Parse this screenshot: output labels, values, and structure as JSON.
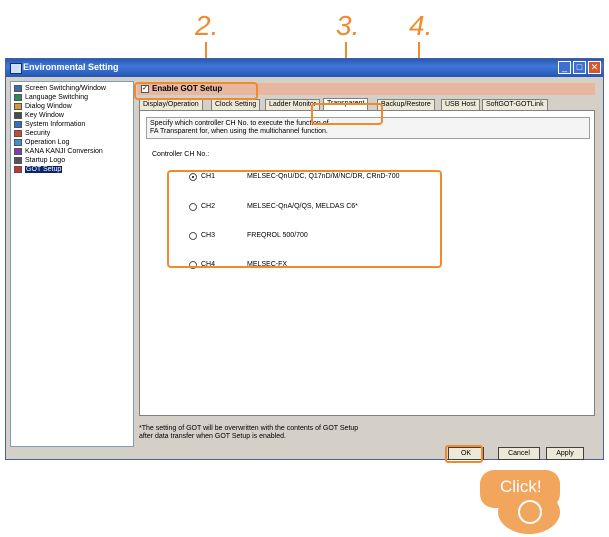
{
  "callouts": [
    "2.",
    "3.",
    "4."
  ],
  "window": {
    "title": "Environmental Setting",
    "controls": [
      "minimize-icon",
      "maximize-icon",
      "close-icon"
    ]
  },
  "tree": {
    "items": [
      {
        "label": "Screen Switching/Window",
        "icon": "screen-icon",
        "color": "#3a6ea5"
      },
      {
        "label": "Language Switching",
        "icon": "language-icon",
        "color": "#2e8b57"
      },
      {
        "label": "Dialog Window",
        "icon": "dialog-icon",
        "color": "#d49c2c"
      },
      {
        "label": "Key Window",
        "icon": "key-window-icon",
        "color": "#4a4a4a"
      },
      {
        "label": "System Information",
        "icon": "system-info-icon",
        "color": "#2f73c9"
      },
      {
        "label": "Security",
        "icon": "security-icon",
        "color": "#c94a2f"
      },
      {
        "label": "Operation Log",
        "icon": "operation-log-icon",
        "color": "#3c8fd0"
      },
      {
        "label": "KANA KANJI Conversion",
        "icon": "kana-kanji-icon",
        "color": "#7a3fb0"
      },
      {
        "label": "Startup Logo",
        "icon": "startup-logo-icon",
        "color": "#555555"
      },
      {
        "label": "GOT Setup",
        "icon": "got-setup-icon",
        "color": "#c0392b"
      }
    ],
    "selected": "GOT Setup"
  },
  "enable": {
    "label": "Enable GOT Setup",
    "checked": true
  },
  "tabs": [
    "Display/Operation",
    "Clock Setting",
    "Ladder Monitor",
    "Transparent",
    "Backup/Restore",
    "USB Host",
    "SoftGOT-GOTLink"
  ],
  "active_tab": "Transparent",
  "description": [
    "Specify which controller CH No. to execute the function of",
    "FA Transparent for, when using the multichannel function."
  ],
  "ch_label": "Controller CH No.:",
  "channels": [
    {
      "name": "CH1",
      "desc": "MELSEC-QnU/DC, Q17nD/M/NC/DR, CRnD-700",
      "selected": true
    },
    {
      "name": "CH2",
      "desc": "MELSEC-QnA/Q/QS, MELDAS C6*",
      "selected": false
    },
    {
      "name": "CH3",
      "desc": "FREQROL 500/700",
      "selected": false
    },
    {
      "name": "CH4",
      "desc": "MELSEC-FX",
      "selected": false
    }
  ],
  "note": [
    "*The setting of GOT will be overwritten with the contents of GOT Setup",
    "after data transfer when GOT Setup is enabled."
  ],
  "buttons": {
    "ok": "OK",
    "cancel": "Cancel",
    "apply": "Apply"
  },
  "click_label": "Click!",
  "accent_color": "#f08a2c"
}
